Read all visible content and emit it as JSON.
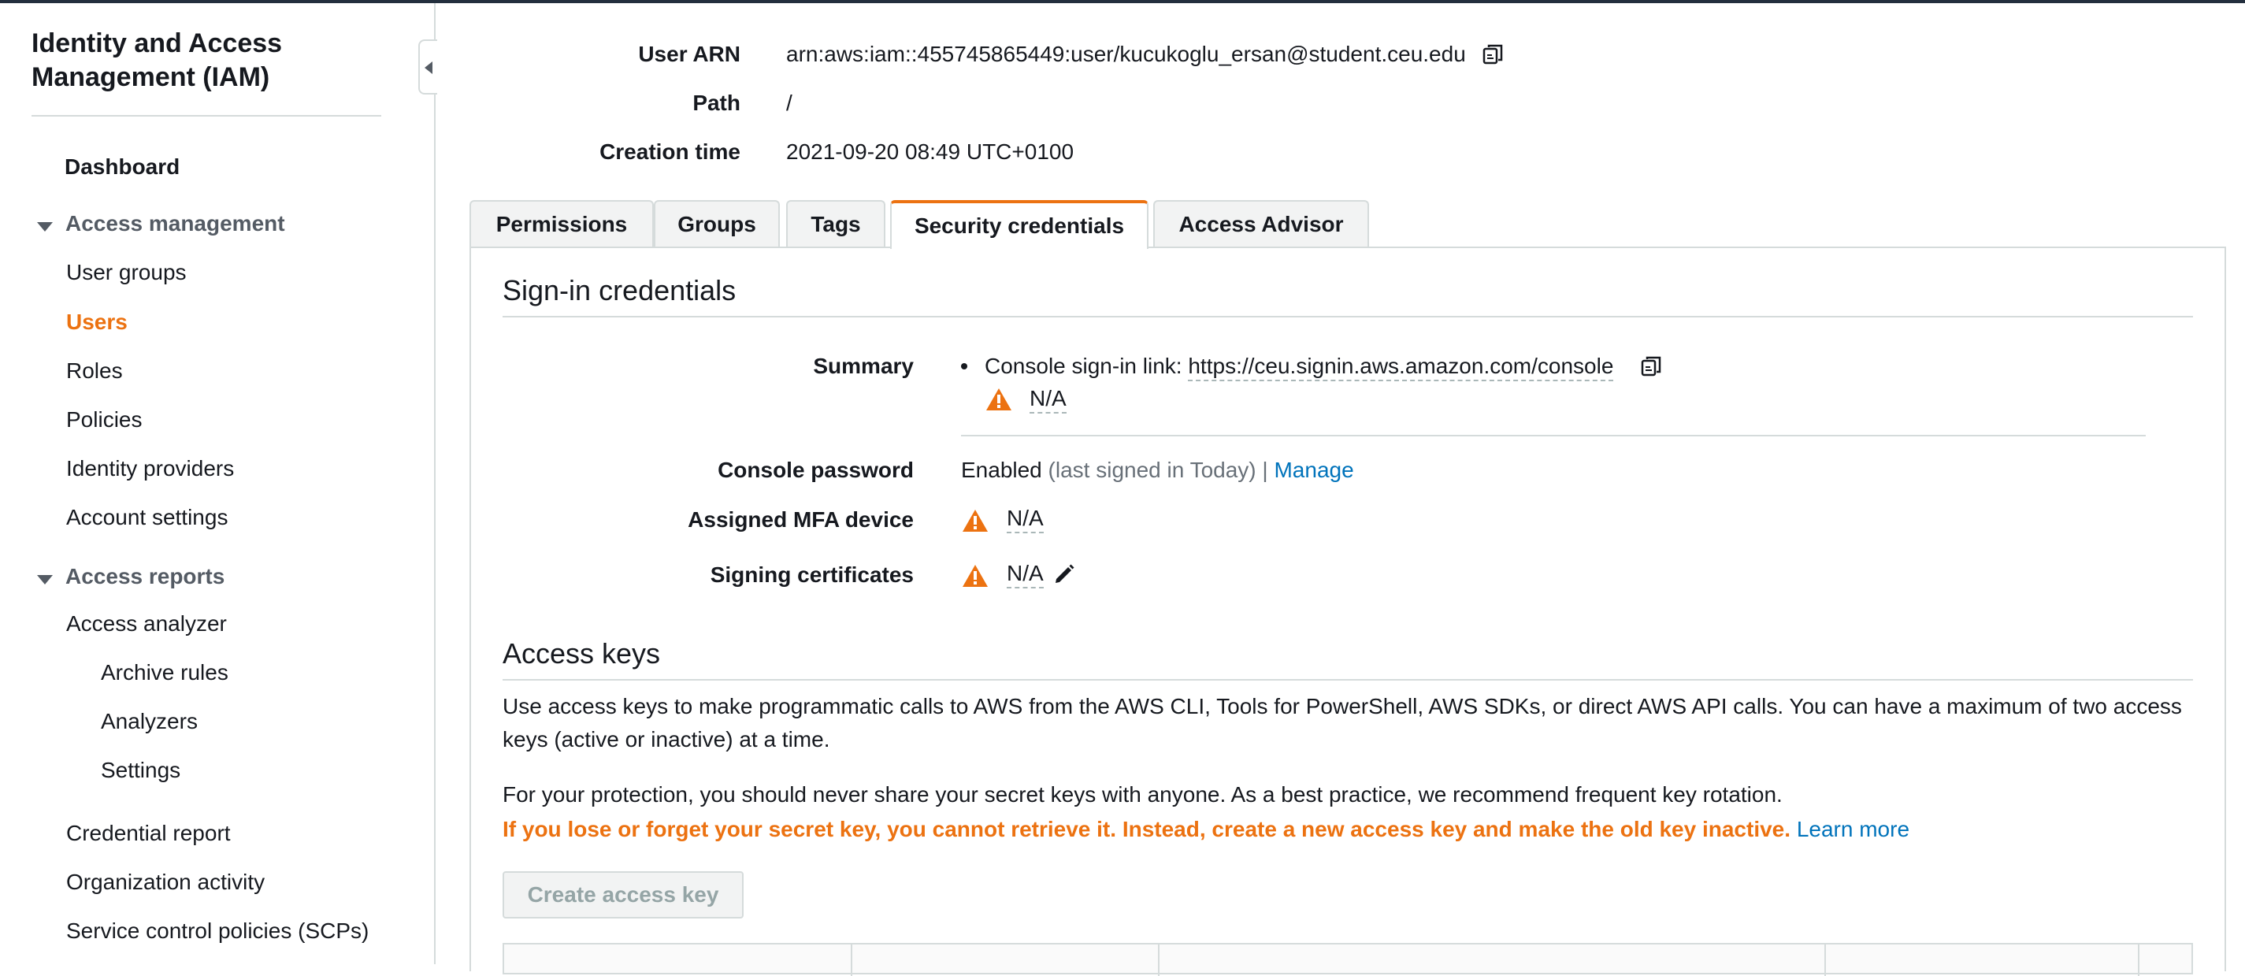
{
  "sidebar": {
    "title": "Identity and Access Management (IAM)",
    "dashboard": "Dashboard",
    "access_management": {
      "label": "Access management",
      "items": [
        "User groups",
        "Users",
        "Roles",
        "Policies",
        "Identity providers",
        "Account settings"
      ],
      "active": "Users"
    },
    "access_reports": {
      "label": "Access reports",
      "items": [
        "Access analyzer"
      ],
      "analyzer_sub": [
        "Archive rules",
        "Analyzers",
        "Settings"
      ],
      "more": [
        "Credential report",
        "Organization activity",
        "Service control policies (SCPs)"
      ]
    }
  },
  "details": {
    "arn_label": "User ARN",
    "arn_value": "arn:aws:iam::455745865449:user/kucukoglu_ersan@student.ceu.edu",
    "path_label": "Path",
    "path_value": "/",
    "created_label": "Creation time",
    "created_value": "2021-09-20 08:49 UTC+0100"
  },
  "tabs": [
    {
      "label": "Permissions"
    },
    {
      "label": "Groups"
    },
    {
      "label": "Tags"
    },
    {
      "label": "Security credentials"
    },
    {
      "label": "Access Advisor"
    }
  ],
  "active_tab": "Security credentials",
  "signin": {
    "title": "Sign-in credentials",
    "summary_label": "Summary",
    "console_link_prefix": "Console sign-in link:",
    "console_link": "https://ceu.signin.aws.amazon.com/console",
    "summary_na": "N/A",
    "password_label": "Console password",
    "password_status": "Enabled",
    "password_note": "(last signed in Today)",
    "separator": "|",
    "manage": "Manage",
    "mfa_label": "Assigned MFA device",
    "mfa_value": "N/A",
    "certs_label": "Signing certificates",
    "certs_value": "N/A"
  },
  "access_keys": {
    "title": "Access keys",
    "desc": "Use access keys to make programmatic calls to AWS from the AWS CLI, Tools for PowerShell, AWS SDKs, or direct AWS API calls. You can have a maximum of two access keys (active or inactive) at a time.",
    "protection": "For your protection, you should never share your secret keys with anyone. As a best practice, we recommend frequent key rotation.",
    "warning": "If you lose or forget your secret key, you cannot retrieve it. Instead, create a new access key and make the old key inactive.",
    "learn_more": "Learn more",
    "create_button": "Create access key"
  },
  "colors": {
    "accent": "#ec7211",
    "link": "#0073bb",
    "border": "#d5dbdb"
  },
  "icons": [
    "copy-icon",
    "warning-icon",
    "pencil-icon",
    "caret-down-icon",
    "collapse-left-icon"
  ]
}
